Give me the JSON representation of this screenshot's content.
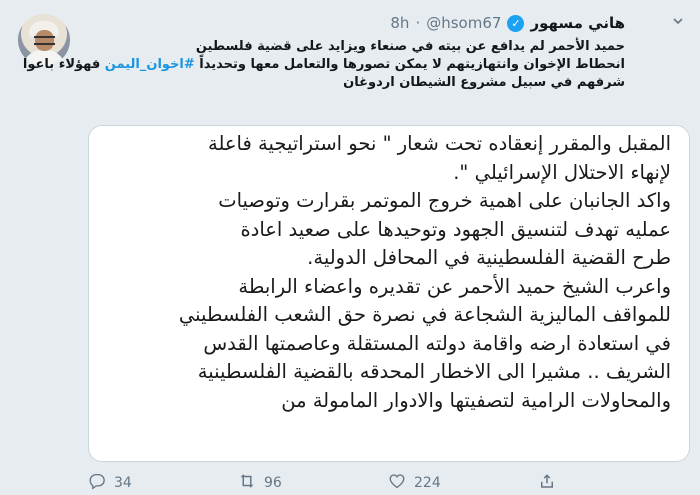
{
  "tweet": {
    "display_name": "هاني مسهور",
    "handle": "@hsom67",
    "separator": "·",
    "time": "8h",
    "text_lines": [
      "حميد الأحمر لم يدافع عن بيته في صنعاء ويزايد على قضية فلسطين",
      "انحطاط الإخوان وانتهازيتهم لا يمكن تصورها والتعامل معها وتحديداً ",
      "شرفهم في سبيل مشروع الشيطان اردوغان"
    ],
    "hashtag": "#اخوان_اليمن",
    "after_hashtag": " فهؤلاء باعوا"
  },
  "media": {
    "lines": [
      "المقبل والمقرر إنعقاده تحت شعار \" نحو استراتيجية فاعلة",
      "لإنهاء الاحتلال الإسرائيلي \".",
      "واكد الجانبان على اهمية خروج الموتمر بقرارت وتوصيات",
      "عمليه تهدف لتنسيق الجهود وتوحيدها على صعيد اعادة",
      "طرح القضية الفلسطينية في المحافل الدولية.",
      "واعرب الشيخ حميد الأحمر عن تقديره واعضاء الرابطة",
      "للمواقف الماليزية الشجاعة في نصرة حق الشعب الفلسطيني",
      "في استعادة ارضه واقامة دولته المستقلة وعاصمتها القدس",
      "الشريف .. مشيرا الى الاخطار المحدقه بالقضية الفلسطينية",
      "والمحاولات الرامية لتصفيتها والادوار المامولة من"
    ]
  },
  "actions": {
    "replies": "34",
    "retweets": "96",
    "likes": "224"
  },
  "icons": {
    "more": "chevron-down-icon",
    "verified": "verified-badge-icon",
    "reply": "reply-icon",
    "retweet": "retweet-icon",
    "like": "heart-icon",
    "share": "share-icon"
  },
  "colors": {
    "background": "#e6ecf0",
    "link": "#1b95e0",
    "verified": "#1da1f2",
    "muted": "#657786"
  }
}
